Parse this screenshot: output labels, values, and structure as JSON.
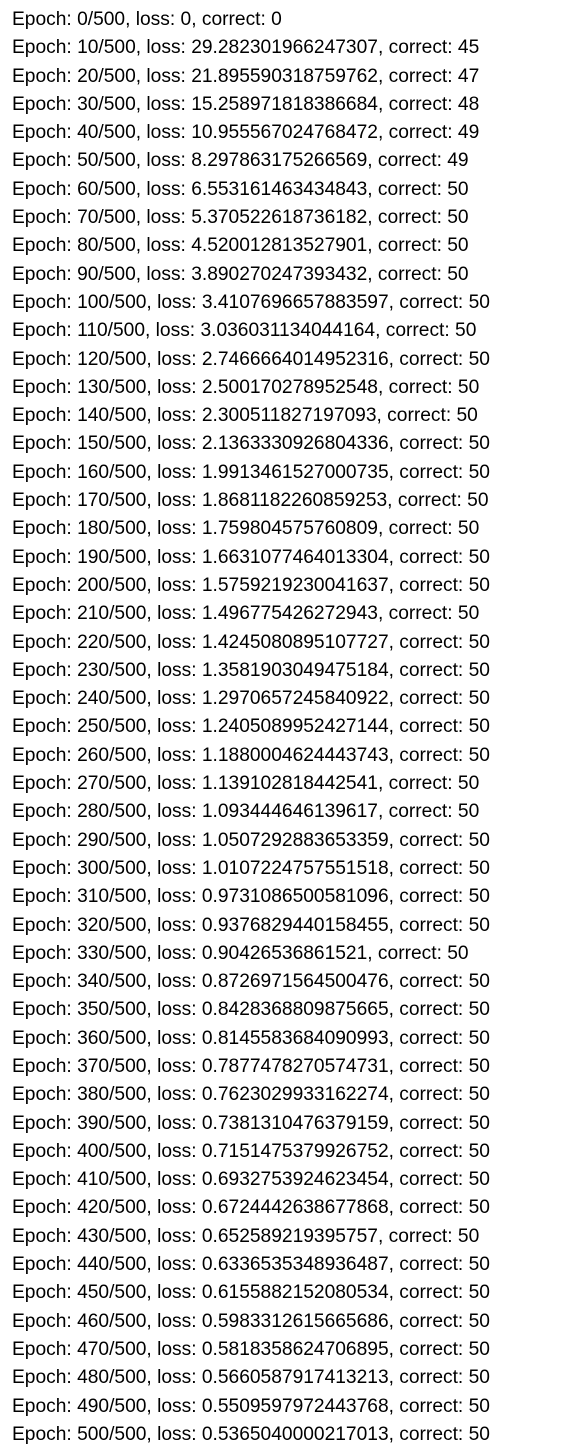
{
  "log": {
    "lines": [
      "Epoch: 0/500, loss: 0, correct: 0",
      "Epoch: 10/500, loss: 29.282301966247307, correct: 45",
      "Epoch: 20/500, loss: 21.895590318759762, correct: 47",
      "Epoch: 30/500, loss: 15.258971818386684, correct: 48",
      "Epoch: 40/500, loss: 10.955567024768472, correct: 49",
      "Epoch: 50/500, loss: 8.297863175266569, correct: 49",
      "Epoch: 60/500, loss: 6.553161463434843, correct: 50",
      "Epoch: 70/500, loss: 5.370522618736182, correct: 50",
      "Epoch: 80/500, loss: 4.520012813527901, correct: 50",
      "Epoch: 90/500, loss: 3.890270247393432, correct: 50",
      "Epoch: 100/500, loss: 3.4107696657883597, correct: 50",
      "Epoch: 110/500, loss: 3.036031134044164, correct: 50",
      "Epoch: 120/500, loss: 2.7466664014952316, correct: 50",
      "Epoch: 130/500, loss: 2.500170278952548, correct: 50",
      "Epoch: 140/500, loss: 2.300511827197093, correct: 50",
      "Epoch: 150/500, loss: 2.1363330926804336, correct: 50",
      "Epoch: 160/500, loss: 1.9913461527000735, correct: 50",
      "Epoch: 170/500, loss: 1.8681182260859253, correct: 50",
      "Epoch: 180/500, loss: 1.759804575760809, correct: 50",
      "Epoch: 190/500, loss: 1.6631077464013304, correct: 50",
      "Epoch: 200/500, loss: 1.5759219230041637, correct: 50",
      "Epoch: 210/500, loss: 1.496775426272943, correct: 50",
      "Epoch: 220/500, loss: 1.4245080895107727, correct: 50",
      "Epoch: 230/500, loss: 1.3581903049475184, correct: 50",
      "Epoch: 240/500, loss: 1.2970657245840922, correct: 50",
      "Epoch: 250/500, loss: 1.2405089952427144, correct: 50",
      "Epoch: 260/500, loss: 1.1880004624443743, correct: 50",
      "Epoch: 270/500, loss: 1.139102818442541, correct: 50",
      "Epoch: 280/500, loss: 1.093444646139617, correct: 50",
      "Epoch: 290/500, loss: 1.0507292883653359, correct: 50",
      "Epoch: 300/500, loss: 1.0107224757551518, correct: 50",
      "Epoch: 310/500, loss: 0.9731086500581096, correct: 50",
      "Epoch: 320/500, loss: 0.9376829440158455, correct: 50",
      "Epoch: 330/500, loss: 0.90426536861521, correct: 50",
      "Epoch: 340/500, loss: 0.8726971564500476, correct: 50",
      "Epoch: 350/500, loss: 0.8428368809875665, correct: 50",
      "Epoch: 360/500, loss: 0.8145583684090993, correct: 50",
      "Epoch: 370/500, loss: 0.7877478270574731, correct: 50",
      "Epoch: 380/500, loss: 0.7623029933162274, correct: 50",
      "Epoch: 390/500, loss: 0.7381310476379159, correct: 50",
      "Epoch: 400/500, loss: 0.7151475379926752, correct: 50",
      "Epoch: 410/500, loss: 0.6932753924623454, correct: 50",
      "Epoch: 420/500, loss: 0.6724442638677868, correct: 50",
      "Epoch: 430/500, loss: 0.652589219395757, correct: 50",
      "Epoch: 440/500, loss: 0.6336535348936487, correct: 50",
      "Epoch: 450/500, loss: 0.6155882152080534, correct: 50",
      "Epoch: 460/500, loss: 0.5983312615665686, correct: 50",
      "Epoch: 470/500, loss: 0.5818358624706895, correct: 50",
      "Epoch: 480/500, loss: 0.5660587917413213, correct: 50",
      "Epoch: 490/500, loss: 0.5509597972443768, correct: 50",
      "Epoch: 500/500, loss: 0.5365040000217013, correct: 50"
    ]
  }
}
